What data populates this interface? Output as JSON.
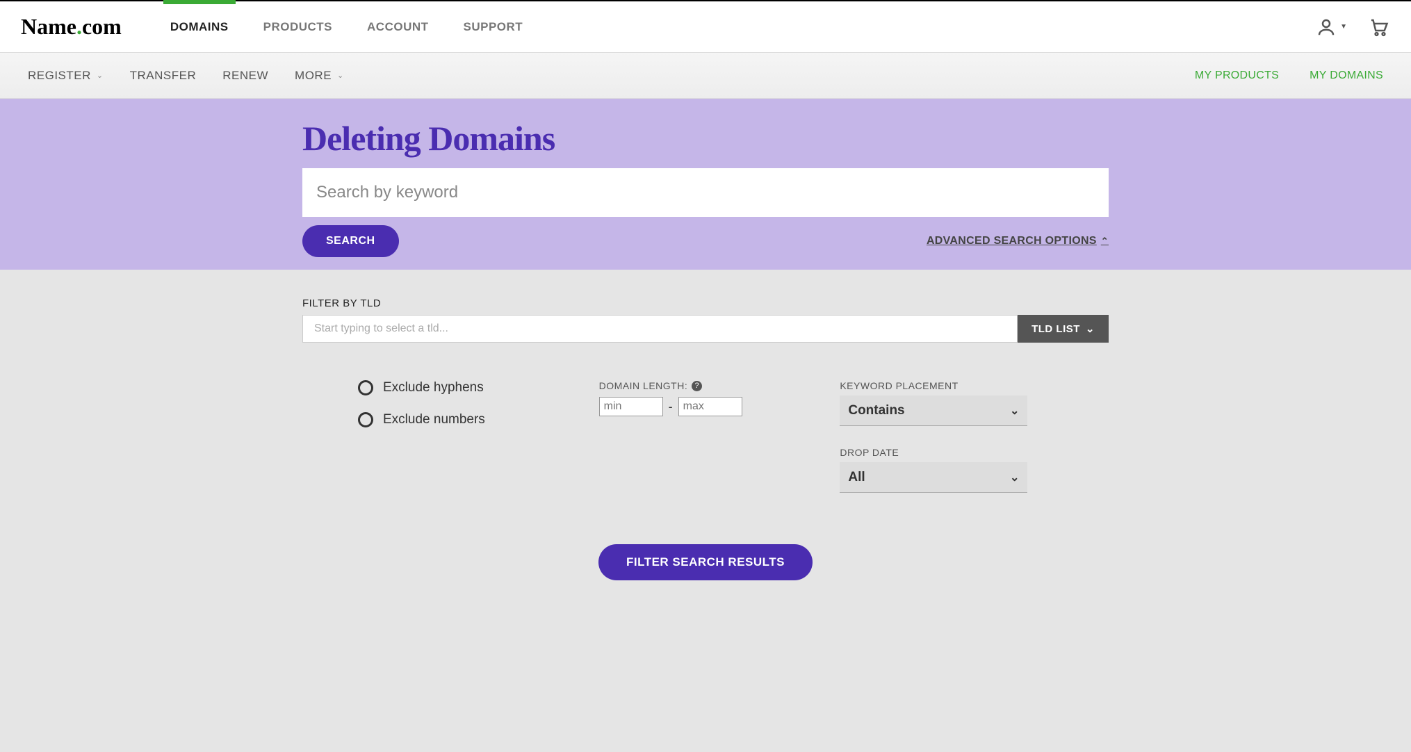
{
  "logo": {
    "part1": "Name",
    "dot": ".",
    "part2": "com"
  },
  "topnav": {
    "domains": "DOMAINS",
    "products": "PRODUCTS",
    "account": "ACCOUNT",
    "support": "SUPPORT"
  },
  "subnav": {
    "register": "REGISTER",
    "transfer": "TRANSFER",
    "renew": "RENEW",
    "more": "MORE"
  },
  "subnav_right": {
    "my_products": "MY PRODUCTS",
    "my_domains": "MY DOMAINS"
  },
  "hero": {
    "title": "Deleting Domains",
    "search_placeholder": "Search by keyword",
    "search_button": "SEARCH",
    "advanced": "ADVANCED SEARCH OPTIONS"
  },
  "filters": {
    "filter_by_tld": "FILTER BY TLD",
    "tld_placeholder": "Start typing to select a tld...",
    "tld_list_btn": "TLD LIST",
    "exclude_hyphens": "Exclude hyphens",
    "exclude_numbers": "Exclude numbers",
    "domain_length": "DOMAIN LENGTH:",
    "min_placeholder": "min",
    "max_placeholder": "max",
    "keyword_placement": "KEYWORD PLACEMENT",
    "keyword_value": "Contains",
    "drop_date": "DROP DATE",
    "drop_value": "All",
    "filter_button": "FILTER SEARCH RESULTS"
  }
}
